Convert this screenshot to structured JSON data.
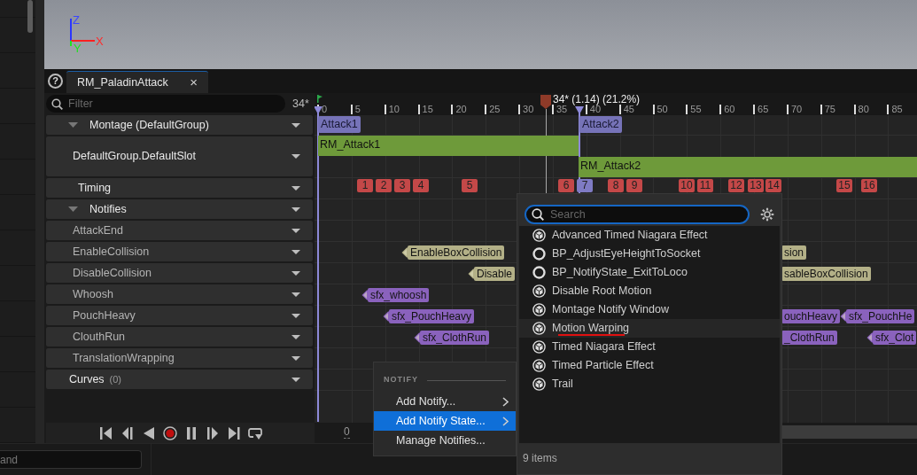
{
  "viewport": {
    "axes": [
      {
        "label": "Z",
        "color": "#3a46ff"
      },
      {
        "label": "X",
        "color": "#ff2a2a"
      },
      {
        "label": "Y",
        "color": "#22e022"
      }
    ]
  },
  "help": "?",
  "tab": {
    "title": "RM_PaladinAttack",
    "close": "×"
  },
  "filter": {
    "placeholder": "Filter",
    "frame": "34*"
  },
  "tracks": [
    {
      "label": "Montage (DefaultGroup)",
      "kind": "group",
      "expanded": true
    },
    {
      "label": "DefaultGroup.DefaultSlot",
      "kind": "slot"
    },
    {
      "label": "Timing",
      "kind": "timing"
    },
    {
      "label": "Notifies",
      "kind": "group",
      "expanded": true
    },
    {
      "label": "AttackEnd",
      "kind": "notify"
    },
    {
      "label": "EnableCollision",
      "kind": "notify",
      "events": [
        {
          "label": "EnableBoxCollision",
          "color": "#b3b087"
        },
        {
          "label": "sion",
          "color": "#b3b087"
        }
      ]
    },
    {
      "label": "DisableCollision",
      "kind": "notify",
      "events": [
        {
          "label": "Disable",
          "color": "#b3b087"
        },
        {
          "label": "sableBoxCollision",
          "color": "#b3b087"
        }
      ]
    },
    {
      "label": "Whoosh",
      "kind": "notify",
      "events": [
        {
          "label": "sfx_whoosh",
          "color": "#8a62bd"
        }
      ]
    },
    {
      "label": "PouchHeavy",
      "kind": "notify",
      "events": [
        {
          "label": "sfx_PouchHeavy",
          "color": "#8a62bd"
        },
        {
          "label": "ouchHeavy",
          "color": "#8a62bd"
        },
        {
          "label": "sfx_PouchHe",
          "color": "#8a62bd"
        }
      ]
    },
    {
      "label": "ClouthRun",
      "kind": "notify",
      "events": [
        {
          "label": "sfx_ClothRun",
          "color": "#8a62bd"
        },
        {
          "label": "_ClothRun",
          "color": "#8a62bd"
        },
        {
          "label": "sfx_Clot",
          "color": "#8a62bd"
        }
      ]
    },
    {
      "label": "TranslationWrapping",
      "kind": "notify"
    },
    {
      "label": "Curves",
      "kind": "curves",
      "count": "(0)"
    }
  ],
  "transport": [
    {
      "kind": "to-start"
    },
    {
      "kind": "step-back"
    },
    {
      "kind": "play-reverse"
    },
    {
      "kind": "record"
    },
    {
      "kind": "pause"
    },
    {
      "kind": "step-forward"
    },
    {
      "kind": "to-end"
    },
    {
      "kind": "loop"
    }
  ],
  "timeline": {
    "ruler": [
      "0",
      "5",
      "10",
      "15",
      "20",
      "25",
      "30",
      "35",
      "40",
      "45",
      "50",
      "55",
      "60",
      "65",
      "70",
      "75",
      "80",
      "85"
    ],
    "playhead": "34* (1.14) (21.2%)",
    "sections": [
      "Attack1",
      "Attack2"
    ],
    "segments": [
      "RM_Attack1",
      "RM_Attack2"
    ],
    "markers": [
      {
        "label": "1",
        "color": "#c44848"
      },
      {
        "label": "2",
        "color": "#c44848"
      },
      {
        "label": "3",
        "color": "#c44848"
      },
      {
        "label": "4",
        "color": "#c44848"
      },
      {
        "label": "5",
        "color": "#c44848"
      },
      {
        "label": "6",
        "color": "#c44848"
      },
      {
        "label": "7",
        "color": "#7f7bc4"
      },
      {
        "label": "8",
        "color": "#c44848"
      },
      {
        "label": "9",
        "color": "#c44848"
      },
      {
        "label": "10",
        "color": "#c44848"
      },
      {
        "label": "11",
        "color": "#c44848"
      },
      {
        "label": "12",
        "color": "#c44848"
      },
      {
        "label": "13",
        "color": "#c44848"
      },
      {
        "label": "14",
        "color": "#c44848"
      },
      {
        "label": "15",
        "color": "#c44848"
      },
      {
        "label": "16",
        "color": "#c44848"
      }
    ],
    "frame": "0"
  },
  "context_menu": {
    "header": "NOTIFY",
    "items": [
      {
        "label": "Add Notify...",
        "submenu": true,
        "selected": false
      },
      {
        "label": "Add Notify State...",
        "submenu": true,
        "selected": true
      },
      {
        "label": "Manage Notifies...",
        "submenu": false,
        "selected": false
      }
    ]
  },
  "picker": {
    "placeholder": "Search",
    "items": [
      {
        "label": "Advanced Timed Niagara Effect",
        "kind": "cube",
        "selected": false,
        "underlined": false
      },
      {
        "label": "BP_AdjustEyeHeightToSocket",
        "kind": "ring",
        "selected": false,
        "underlined": false
      },
      {
        "label": "BP_NotifyState_ExitToLoco",
        "kind": "ring",
        "selected": false,
        "underlined": false
      },
      {
        "label": "Disable Root Motion",
        "kind": "cube",
        "selected": false,
        "underlined": false
      },
      {
        "label": "Montage Notify Window",
        "kind": "cube",
        "selected": false,
        "underlined": false
      },
      {
        "label": "Motion Warping",
        "kind": "cube",
        "selected": true,
        "underlined": true
      },
      {
        "label": "Timed Niagara Effect",
        "kind": "cube",
        "selected": false,
        "underlined": false
      },
      {
        "label": "Timed Particle Effect",
        "kind": "cube",
        "selected": false,
        "underlined": false
      },
      {
        "label": "Trail",
        "kind": "cube",
        "selected": false,
        "underlined": false
      }
    ],
    "count": "9 items"
  },
  "command_field": {
    "value": "and"
  }
}
